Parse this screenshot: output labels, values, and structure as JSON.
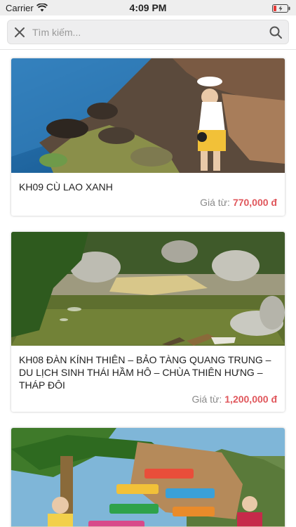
{
  "status_bar": {
    "carrier": "Carrier",
    "time": "4:09 PM",
    "wifi_icon": "wifi-icon",
    "battery_icon": "battery-low-icon"
  },
  "search": {
    "placeholder": "Tìm kiếm...",
    "value": "",
    "close_icon": "close-icon",
    "search_icon": "search-icon"
  },
  "tours": [
    {
      "title": "KH09 CÙ LAO XANH",
      "price_label": "Giá từ:",
      "price": "770,000 đ"
    },
    {
      "title": "KH08 ĐÀN KÍNH THIÊN – BẢO TÀNG QUANG TRUNG – DU LỊCH SINH THÁI HẦM HÔ – CHÙA THIÊN HƯNG – THÁP ĐÔI",
      "price_label": "Giá từ:",
      "price": "1,200,000 đ"
    },
    {
      "title": "",
      "price_label": "",
      "price": ""
    }
  ],
  "colors": {
    "price": "#e0575c",
    "battery_low": "#e53935"
  }
}
